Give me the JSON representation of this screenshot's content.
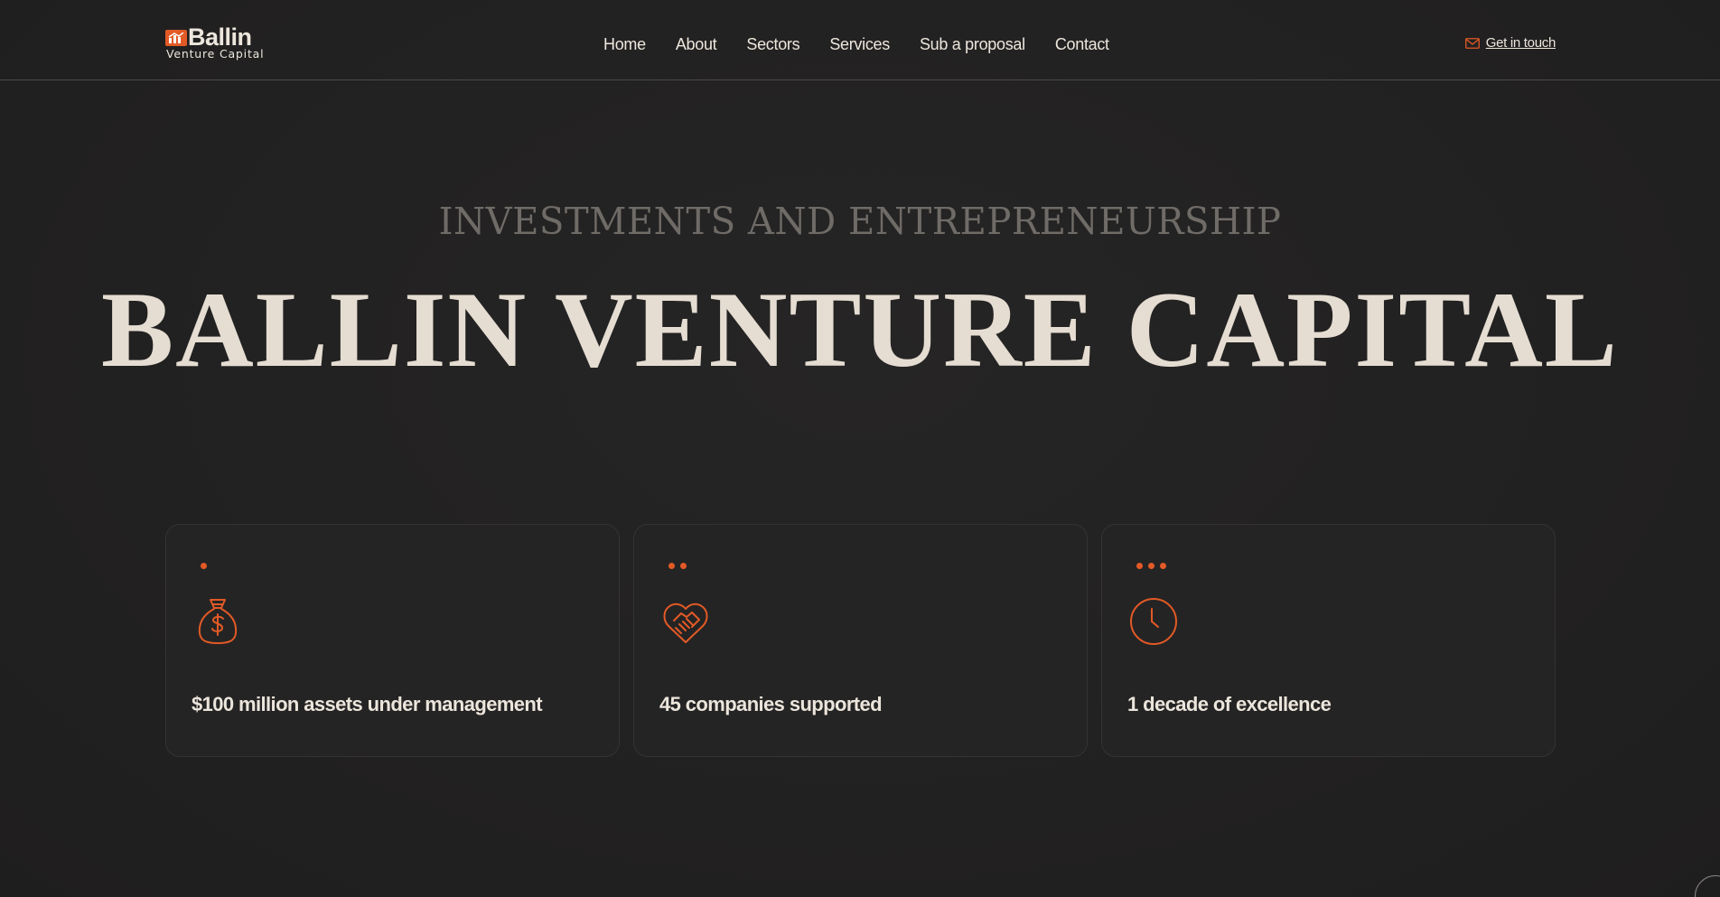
{
  "brand": {
    "name": "Ballin",
    "subtitle": "Venture Capital",
    "accent_color": "#e25a26",
    "logo_icon": "bar-chart-icon"
  },
  "nav": {
    "items": [
      "Home",
      "About",
      "Sectors",
      "Services",
      "Sub a proposal",
      "Contact"
    ]
  },
  "cta": {
    "label": "Get in touch",
    "icon": "mail-icon"
  },
  "hero": {
    "eyebrow": "INVESTMENTS AND ENTREPRENEURSHIP",
    "title": "BALLIN VENTURE CAPITAL"
  },
  "stats": [
    {
      "dots": 1,
      "icon": "money-bag-icon",
      "text": "$100 million assets under management"
    },
    {
      "dots": 2,
      "icon": "handshake-heart-icon",
      "text": "45 companies supported"
    },
    {
      "dots": 3,
      "icon": "clock-icon",
      "text": "1 decade of excellence"
    }
  ]
}
